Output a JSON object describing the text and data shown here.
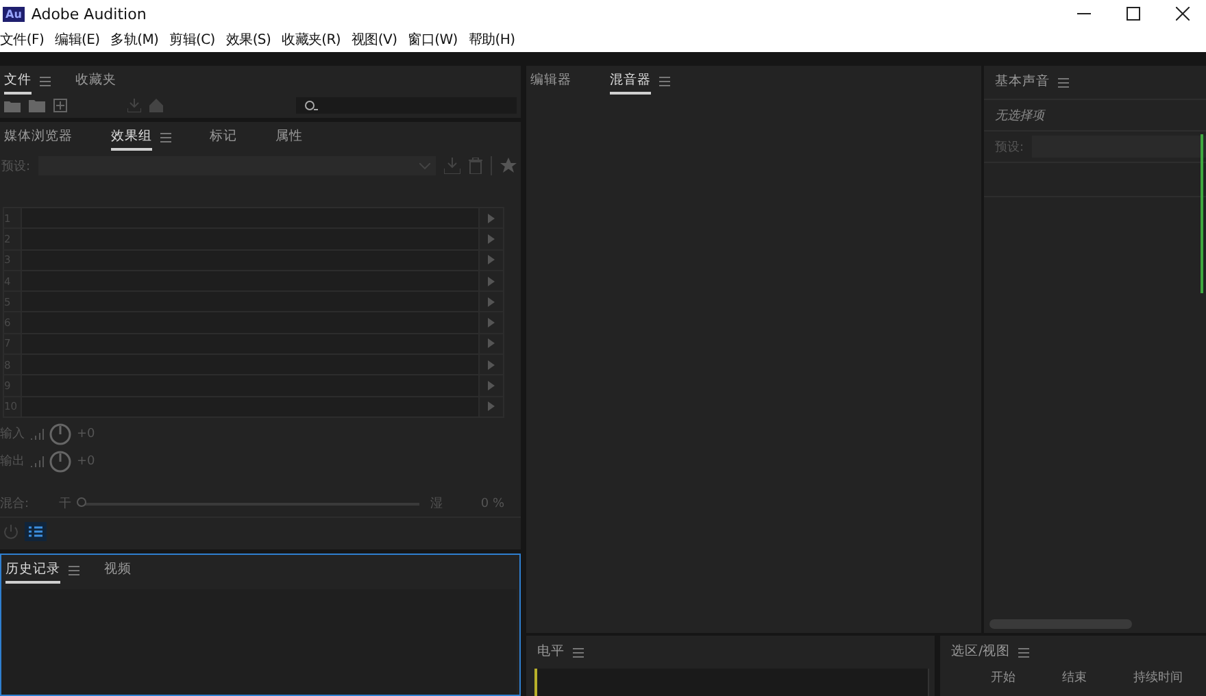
{
  "window": {
    "logo": "Au",
    "title": "Adobe Audition"
  },
  "menu": [
    "文件(F)",
    "编辑(E)",
    "多轨(M)",
    "剪辑(C)",
    "效果(S)",
    "收藏夹(R)",
    "视图(V)",
    "窗口(W)",
    "帮助(H)"
  ],
  "files_panel": {
    "tabs": [
      {
        "label": "文件",
        "selected": true,
        "menu": true
      },
      {
        "label": "收藏夹",
        "selected": false,
        "menu": false
      }
    ]
  },
  "effects_panel": {
    "tabs": [
      {
        "label": "媒体浏览器",
        "selected": false,
        "menu": false
      },
      {
        "label": "效果组",
        "selected": true,
        "menu": true
      },
      {
        "label": "标记",
        "selected": false,
        "menu": false
      },
      {
        "label": "属性",
        "selected": false,
        "menu": false
      }
    ],
    "preset_label": "预设:",
    "rack": [
      "1",
      "2",
      "3",
      "4",
      "5",
      "6",
      "7",
      "8",
      "9",
      "10"
    ],
    "io": [
      {
        "label": "输入",
        "value": "+0"
      },
      {
        "label": "输出",
        "value": "+0"
      }
    ],
    "mix": {
      "label": "混合:",
      "dry": "干",
      "wet": "湿",
      "level": 0,
      "reading": "0 %"
    }
  },
  "history_panel": {
    "tabs": [
      {
        "label": "历史记录",
        "selected": true,
        "menu": true
      },
      {
        "label": "视频",
        "selected": false,
        "menu": false
      }
    ]
  },
  "center_panel": {
    "tabs": [
      {
        "label": "编辑器",
        "selected": false,
        "menu": false
      },
      {
        "label": "混音器",
        "selected": true,
        "menu": true
      }
    ]
  },
  "essential_sound": {
    "title": "基本声音",
    "empty": "无选择项",
    "preset_label": "预设:"
  },
  "level_panel": {
    "title": "电平"
  },
  "selection_panel": {
    "title": "选区/视图",
    "columns": [
      "开始",
      "结束",
      "持续时间"
    ]
  }
}
